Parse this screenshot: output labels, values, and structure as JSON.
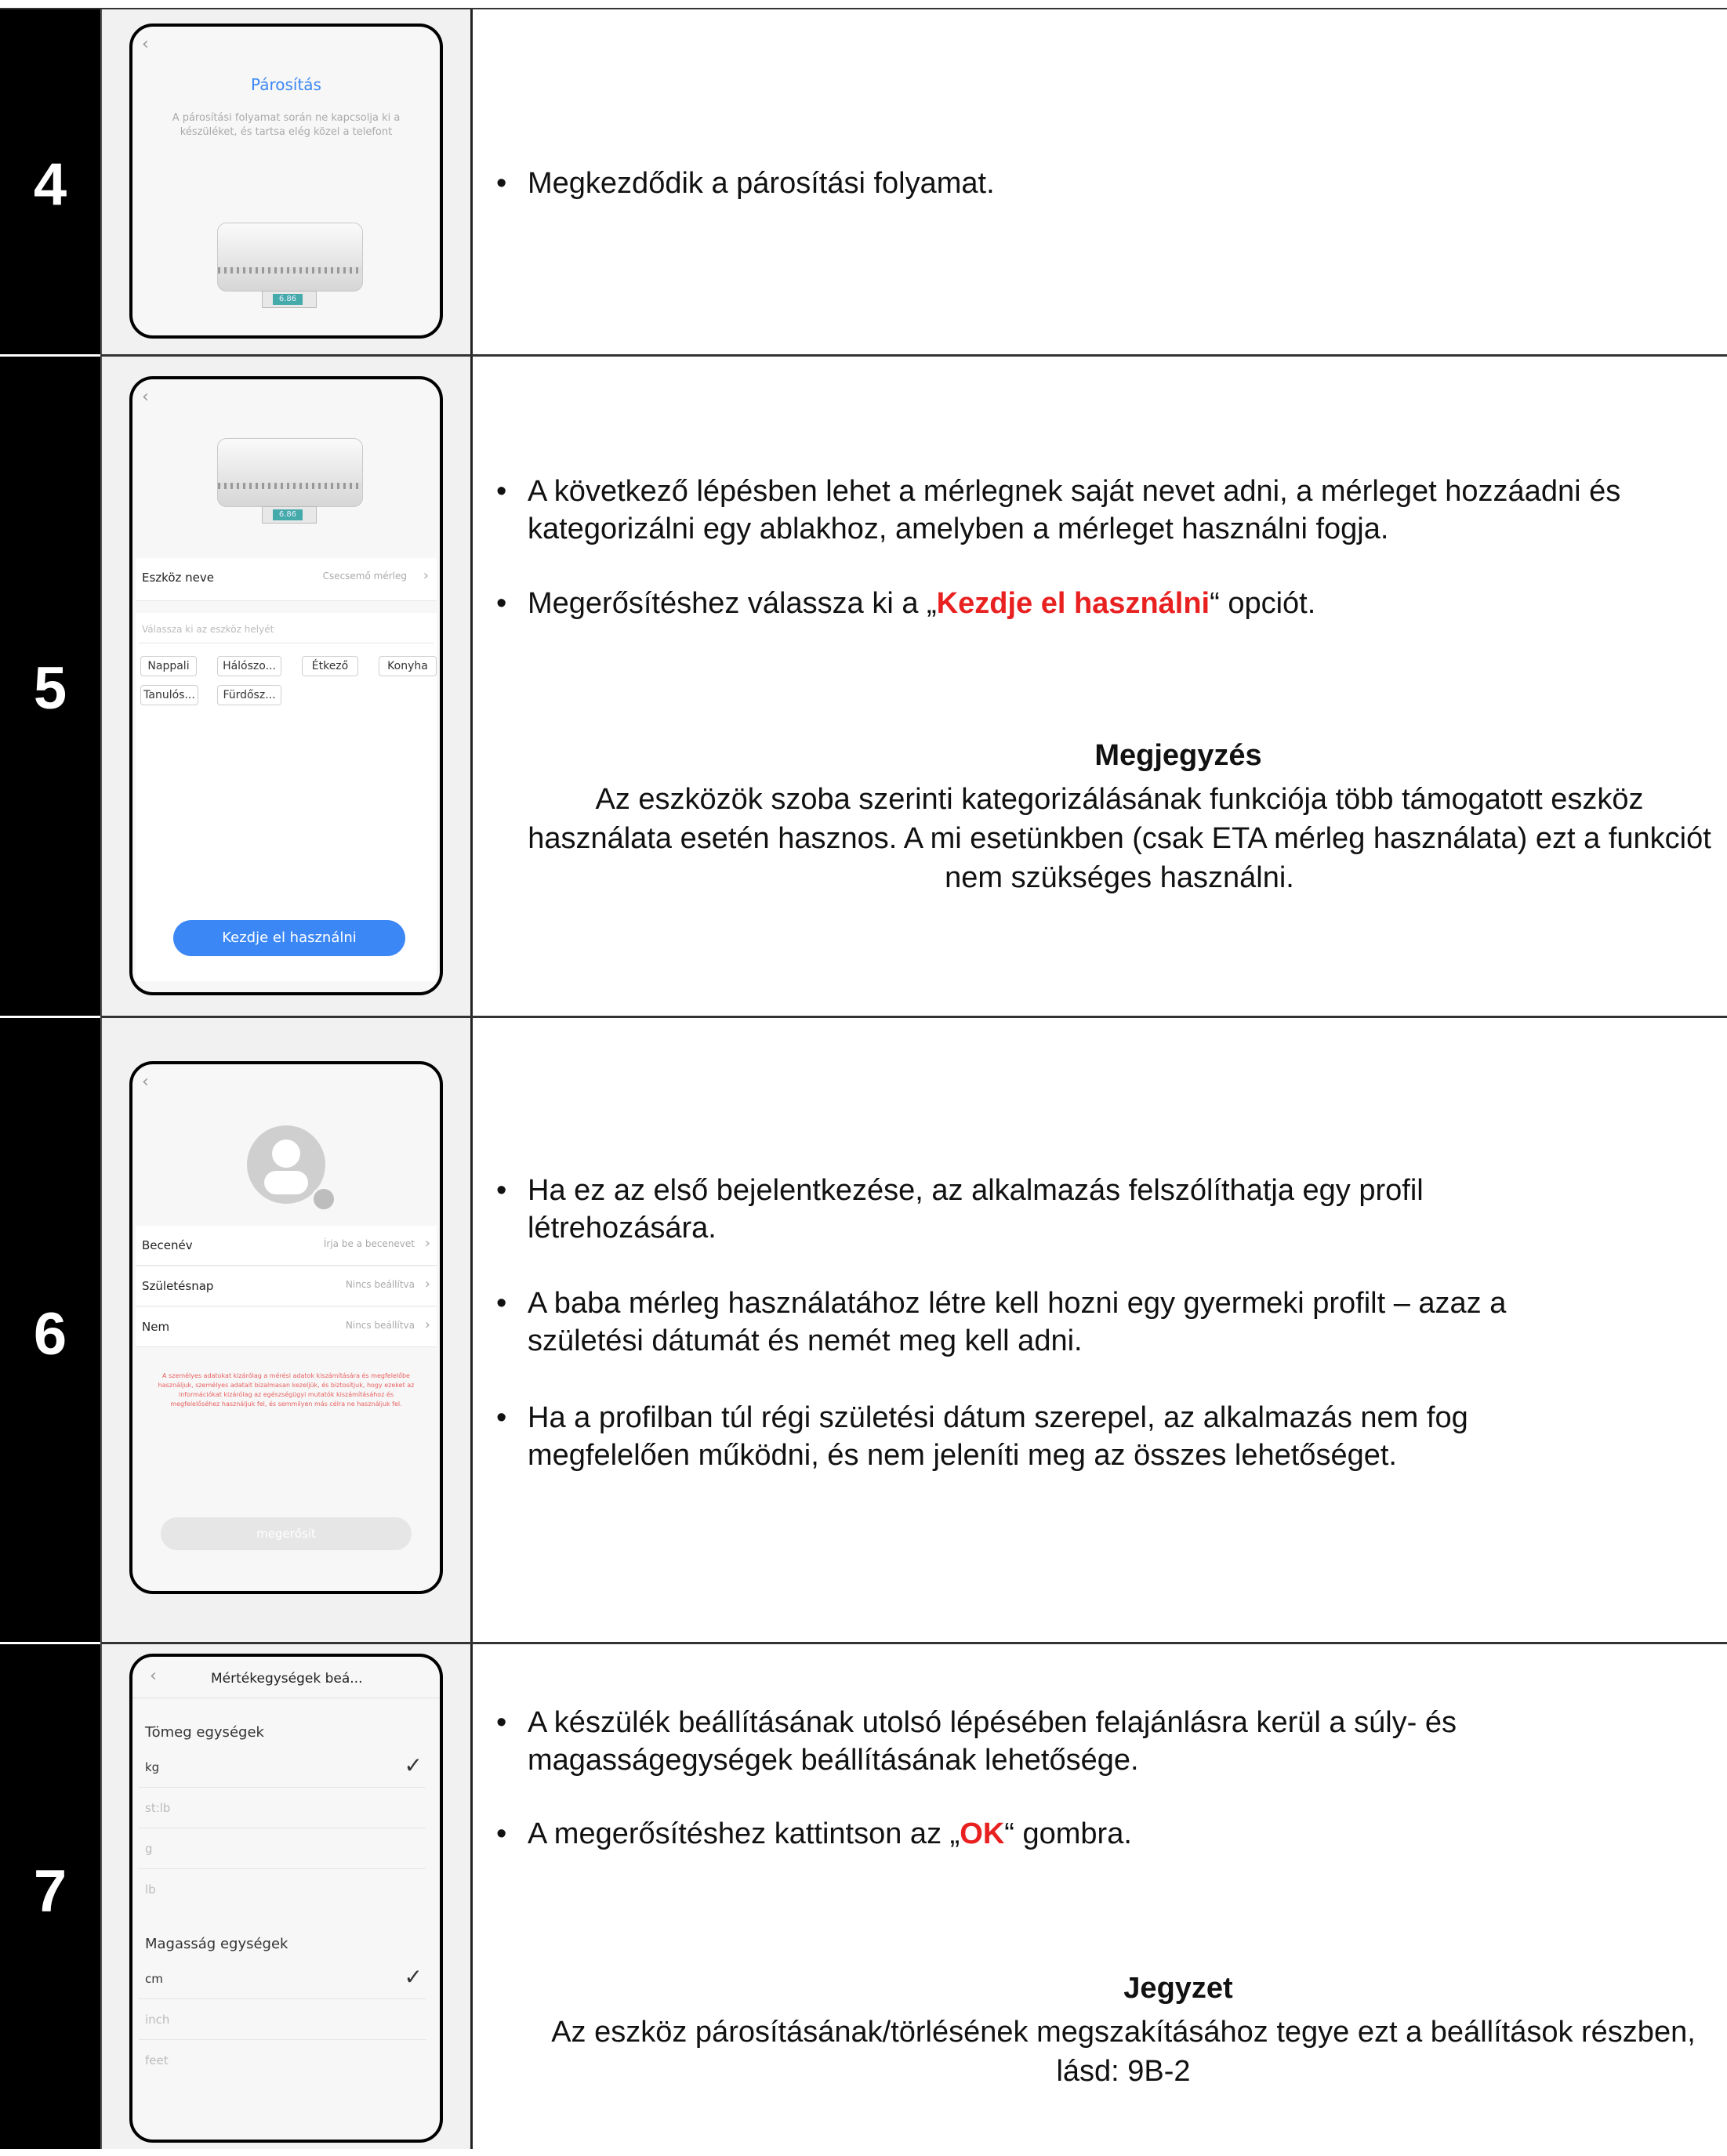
{
  "steps": [
    {
      "number": "4",
      "phone": {
        "title": "Párosítás",
        "subtitle": "A párosítási folyamat során ne kapcsolja ki a készüléket, és tartsa elég közel a telefont",
        "display": "6.86"
      },
      "bullets": [
        "Megkezdődik a párosítási folyamat."
      ]
    },
    {
      "number": "5",
      "phone": {
        "display": "6.86",
        "device_name_label": "Eszköz neve",
        "device_name_value": "Csecsemő mérleg",
        "room_placeholder": "Válassza ki az eszköz helyét",
        "rooms": [
          "Nappali",
          "Hálószo...",
          "Étkező",
          "Konyha",
          "Tanulós...",
          "Fürdősz..."
        ],
        "start_button": "Kezdje el használni"
      },
      "bullets": [
        "A következő lépésben lehet a mérlegnek saját nevet adni, a mérleget hozzáadni és kategorizálni egy ablakhoz, amelyben a mérleget használni fogja.",
        {
          "before": "Megerősítéshez válassza ki a „",
          "highlight": "Kezdje el használni",
          "after": "“ opciót."
        }
      ],
      "note": {
        "title": "Megjegyzés",
        "text": "Az eszközök szoba szerinti kategorizálásának funkciója több támogatott eszköz használata esetén hasznos. A mi esetünkben (csak ETA mérleg használata) ezt a funkciót nem szükséges használni."
      }
    },
    {
      "number": "6",
      "phone": {
        "rows": [
          {
            "label": "Becenév",
            "value": "Írja be a becenevet"
          },
          {
            "label": "Születésnap",
            "value": "Nincs beállítva"
          },
          {
            "label": "Nem",
            "value": "Nincs beállítva"
          }
        ],
        "privacy": "A személyes adatokat kizárólag a mérési adatok kiszámítására és megfelelőbe használjuk, személyes adatait bizalmasan kezeljük, és biztosítjuk, hogy ezeket az információkat kizárólag az egészségügyi mutatók kiszámításához és megfelelőséhez használjuk fel, és semmilyen más célra ne használjuk fel.",
        "confirm_button": "megerősít"
      },
      "bullets": [
        "Ha ez az első bejelentkezése, az alkalmazás felszólíthatja egy profil létrehozására.",
        "A baba mérleg használatához létre kell hozni egy gyermeki profilt – azaz a születési dátumát és nemét meg kell adni.",
        "Ha a profilban túl régi születési dátum szerepel, az alkalmazás nem fog megfelelően működni, és nem jeleníti meg az összes lehetőséget."
      ]
    },
    {
      "number": "7",
      "phone": {
        "title": "Mértékegységek beá...",
        "weight_header": "Tömeg egységek",
        "weight_units": [
          {
            "label": "kg",
            "checked": true
          },
          {
            "label": "st:lb",
            "checked": false
          },
          {
            "label": "g",
            "checked": false
          },
          {
            "label": "lb",
            "checked": false
          }
        ],
        "height_header": "Magasság egységek",
        "height_units": [
          {
            "label": "cm",
            "checked": true
          },
          {
            "label": "inch",
            "checked": false
          },
          {
            "label": "feet",
            "checked": false
          }
        ]
      },
      "bullets": [
        "A készülék beállításának utolsó lépésében felajánlásra kerül a súly- és magasságegységek beállításának lehetősége.",
        {
          "before": "A megerősítéshez kattintson az „",
          "highlight": "OK",
          "after": "“ gombra."
        }
      ],
      "note": {
        "title": "Jegyzet",
        "text": "Az eszköz párosításának/törlésének megszakításához tegye ezt a beállítások részben, lásd: 9B-2"
      }
    }
  ],
  "colors": {
    "accent_blue": "#3b87f5",
    "highlight_red": "#e82020",
    "dark": "#000000"
  },
  "icons": {
    "back": "chevron-left-icon",
    "check": "check-icon",
    "chevron": "chevron-right-icon",
    "avatar": "avatar-icon",
    "camera": "camera-icon"
  }
}
